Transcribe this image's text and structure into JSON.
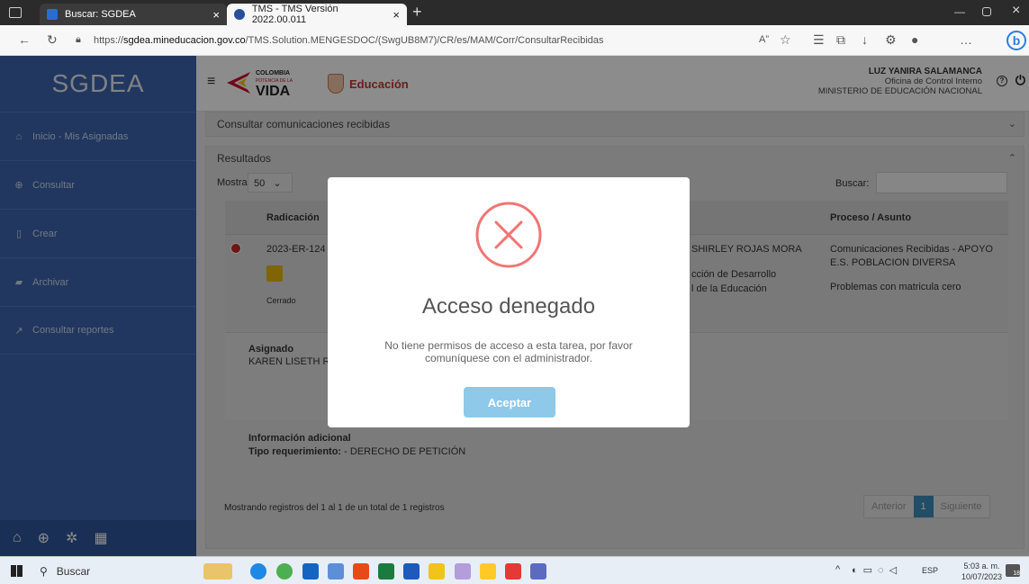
{
  "browser": {
    "tab1_title": "Buscar: SGDEA",
    "tab2_title": "TMS - TMS Versión 2022.00.011",
    "url_prefix": "https://",
    "url_domain": "sgdea.mineducacion.gov.co",
    "url_path": "/TMS.Solution.MENGESDOC/(SwgUB8M7)/CR/es/MAM/Corr/ConsultarRecibidas"
  },
  "sidebar": {
    "logo": "SGDEA",
    "items": [
      {
        "label": "Inicio - Mis Asignadas",
        "icon": "home-icon"
      },
      {
        "label": "Consultar",
        "icon": "search-icon"
      },
      {
        "label": "Crear",
        "icon": "file-icon"
      },
      {
        "label": "Archivar",
        "icon": "folder-icon"
      },
      {
        "label": "Consultar reportes",
        "icon": "chart-icon"
      }
    ]
  },
  "header": {
    "brand_colombia_line1": "COLOMBIA",
    "brand_colombia_line2": "POTENCIA DE LA",
    "brand_colombia_line3": "VIDA",
    "brand_educacion": "Educación",
    "user_name": "LUZ YANIRA SALAMANCA",
    "user_office": "Oficina de Control Interno",
    "user_org": "MINISTERIO DE EDUCACIÓN NACIONAL"
  },
  "consult_panel": {
    "title": "Consultar comunicaciones recibidas"
  },
  "results": {
    "title": "Resultados",
    "show_label": "Mostrar",
    "page_size": "50",
    "search_label": "Buscar:",
    "col_radicacion": "Radicación",
    "col_proceso": "Proceso / Asunto",
    "radicado": "2023-ER-124",
    "estado": "Cerrado",
    "remitente": "SHIRLEY ROJAS MORA",
    "dependencia_1": "cción de Desarrollo",
    "dependencia_2": "l de la Educación",
    "proceso_1": "Comunicaciones Recibidas - APOYO",
    "proceso_2": "E.S. POBLACION DIVERSA",
    "asunto": "Problemas con matricula cero",
    "asignado_label": "Asignado",
    "asignado_value": "KAREN LISETH RI",
    "info_label": "Información adicional",
    "tipo_label": "Tipo requerimiento:",
    "tipo_value": " - DERECHO DE PETICIÓN",
    "footer_text": "Mostrando registros del 1 al 1 de un total de 1 registros",
    "prev": "Anterior",
    "page": "1",
    "next": "Siguiente"
  },
  "modal": {
    "title": "Acceso denegado",
    "message": "No tiene permisos de acceso a esta tarea, por favor comuníquese con el administrador.",
    "button": "Aceptar"
  },
  "taskbar": {
    "search_placeholder": "Buscar",
    "lang": "ESP",
    "time": "5:03 a. m.",
    "date": "10/07/2023",
    "notif_count": "18"
  },
  "colors": {
    "sidebar": "#3c65ad",
    "modal_error": "#f27474",
    "button": "#8ec9ea"
  }
}
